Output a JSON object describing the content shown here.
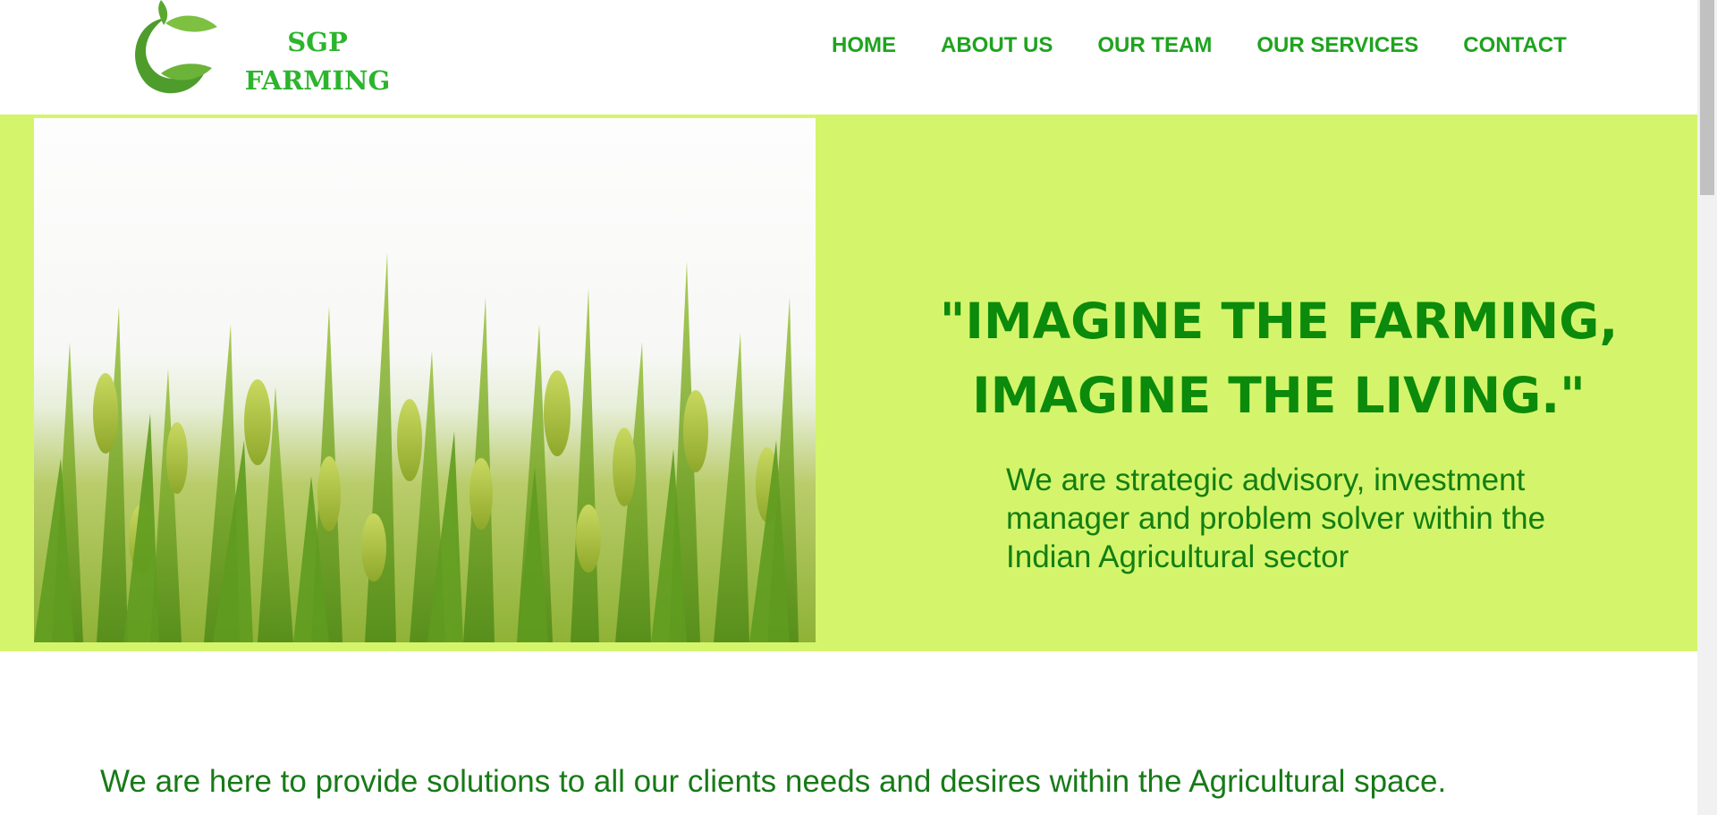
{
  "brand": {
    "name_line1": "SGP",
    "name_line2": "FARMING",
    "logo_icon": "leaf-logo-icon",
    "color": "#2db42d"
  },
  "nav": {
    "items": [
      {
        "label": "HOME"
      },
      {
        "label": "ABOUT US"
      },
      {
        "label": "OUR TEAM"
      },
      {
        "label": "OUR SERVICES"
      },
      {
        "label": "CONTACT"
      }
    ],
    "color": "#1fa31f"
  },
  "hero": {
    "background": "#d4f56b",
    "quote_line1": "\"IMAGINE THE FARMING,",
    "quote_line2": "IMAGINE THE LIVING.\"",
    "tagline": "We are strategic advisory, investment manager and problem solver within the Indian Agricultural sector",
    "image": "rice-field-image",
    "text_color": "#0b8a0b"
  },
  "mission": {
    "text": "We are here to provide solutions to all our clients needs and desires within the Agricultural space."
  }
}
